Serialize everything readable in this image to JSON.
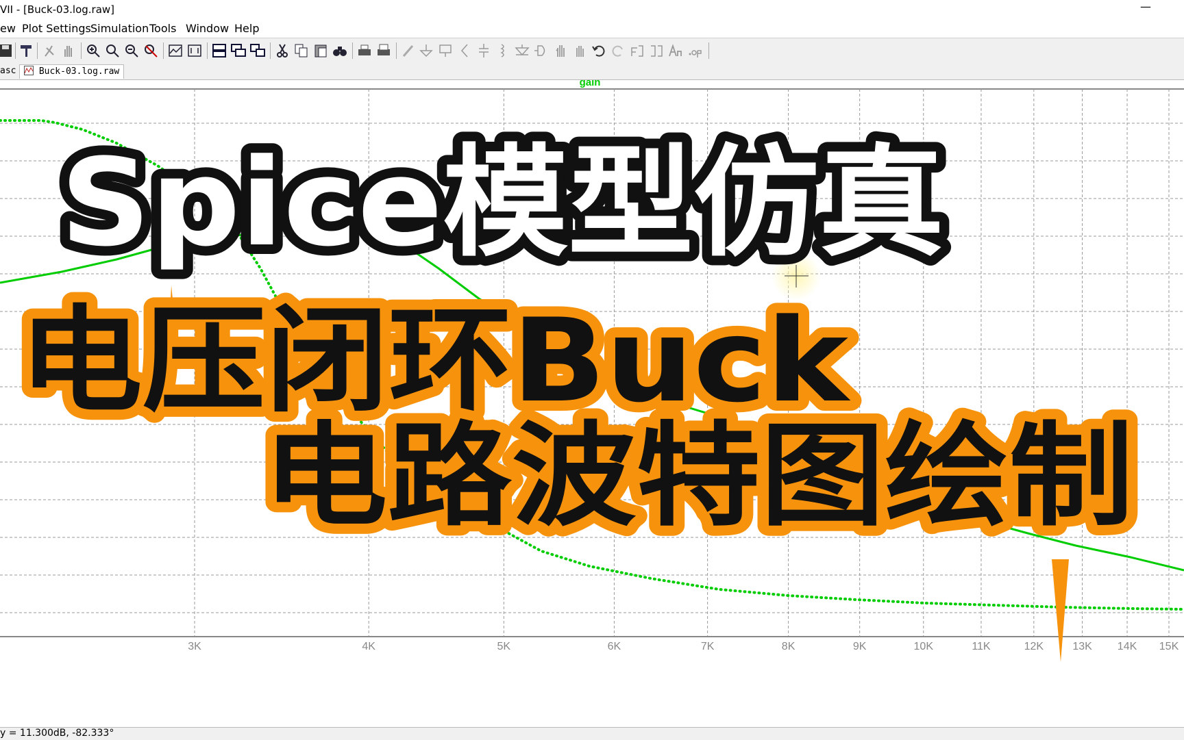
{
  "window": {
    "title": "VII - [Buck-03.log.raw]",
    "minimize_glyph": "—"
  },
  "menu": [
    "ew",
    "Plot Settings",
    "Simulation",
    "Tools",
    "Window",
    "Help"
  ],
  "toolbar_icons": [
    "save-icon",
    "hammer-icon",
    "run-icon",
    "halt-icon",
    "zoom-in-icon",
    "zoom-area-icon",
    "zoom-out-icon",
    "zoom-cancel-icon",
    "autorange-icon",
    "manual-limits-icon",
    "tile-horizontal-icon",
    "cascade-icon",
    "tile-vertical-icon",
    "cut-icon",
    "copy-icon",
    "paste-icon",
    "find-icon",
    "print-icon",
    "print-preview-icon",
    "pencil-icon",
    "ground-icon",
    "label-icon",
    "resistor-icon",
    "capacitor-icon",
    "inductor-icon",
    "diode-icon",
    "component-icon",
    "move-icon",
    "drag-icon",
    "undo-icon",
    "redo-icon",
    "rotate-icon",
    "mirror-icon",
    "text-icon",
    "spice-directive-icon"
  ],
  "tabs": {
    "first": "asc",
    "active": "Buck-03.log.raw"
  },
  "plot": {
    "trace_name": "gain",
    "trace_color": "#00cc00",
    "x_ticks": [
      "3K",
      "4K",
      "5K",
      "6K",
      "7K",
      "8K",
      "9K",
      "10K",
      "11K",
      "12K",
      "13K",
      "14K",
      "15K"
    ]
  },
  "overlay": {
    "line1": "Spice模型仿真",
    "line2": "电压闭环Buck",
    "line3": "电路波特图绘制",
    "colors": {
      "orange": "#f6920c",
      "black": "#111111",
      "white": "#ffffff"
    }
  },
  "status": {
    "text": "y = 11.300dB, -82.333°"
  }
}
